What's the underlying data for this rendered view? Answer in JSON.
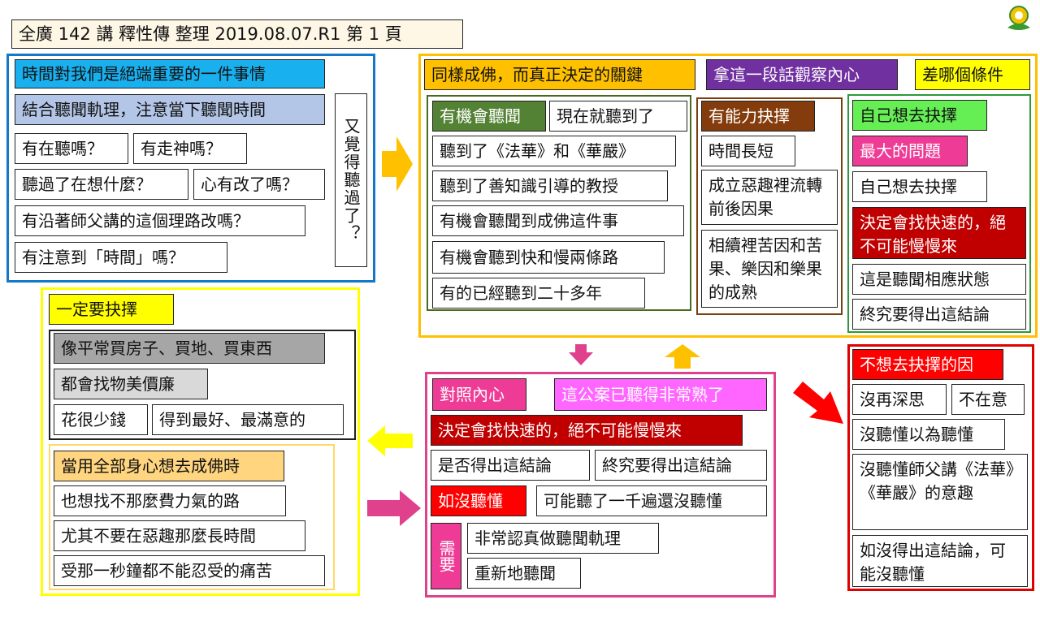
{
  "header": {
    "title": "全廣 142 講   釋性傳 整理  2019.08.07.R1   第 1 頁"
  },
  "colors": {
    "blue": "#1478c8",
    "orange": "#ffc000",
    "yellow": "#ffff00",
    "pink": "#e0418c",
    "red": "#e00000",
    "green": "#2a9a3a",
    "brown": "#7a3e10",
    "darkgreen": "#4a6a20"
  },
  "blue_box": {
    "title": "時間對我們是絕端重要的一件事情",
    "subtitle": "結合聽聞軌理，注意當下聽聞時間",
    "q1": "有在聽嗎？",
    "q2": "有走神嗎？",
    "q3": "聽過了在想什麼？",
    "q4": "心有改了嗎？",
    "q5": "有沿著師父講的這個理路改嗎？",
    "q6": "有注意到「時間」嗎？",
    "side": "又覺得聽過了？"
  },
  "orange_box": {
    "title": "同樣成佛，而真正決定的關鍵",
    "purple": "拿這一段話觀察內心",
    "yellow": "差哪個條件",
    "col1": {
      "head": "有機會聽聞",
      "head2": "現在就聽到了",
      "items": [
        "聽到了《法華》和《華嚴》",
        "聽到了善知識引導的教授",
        "有機會聽聞到成佛這件事",
        "有機會聽到快和慢兩條路",
        "有的已經聽到二十多年"
      ]
    },
    "col2": {
      "head": "有能力抉擇",
      "items": [
        "時間長短",
        "成立惡趣裡流轉前後因果",
        "相續裡苦因和苦果、樂因和樂果的成熟"
      ]
    },
    "col3": {
      "head": "自己想去抉擇",
      "problem": "最大的問題",
      "item1": "自己想去抉擇",
      "red": "決定會找快速的，絕不可能慢慢來",
      "item2": "這是聽聞相應狀態",
      "item3": "終究要得出這結論"
    }
  },
  "yellow_box": {
    "title": "一定要抉擇",
    "g1": "像平常買房子、買地、買東西",
    "g2": "都會找物美價廉",
    "g3": "花很少錢",
    "g4": "得到最好、最滿意的",
    "sub_title": "當用全部身心想去成佛時",
    "s1": "也想找不那麼費力氣的路",
    "s2": "尤其不要在惡趣那麼長時間",
    "s3": "受那一秒鐘都不能忍受的痛苦"
  },
  "pink_box": {
    "t1": "對照內心",
    "t2": "這公案已聽得非常熟了",
    "red": "決定會找快速的，絕不可能慢慢來",
    "a1": "是否得出這結論",
    "a2": "終究要得出這結論",
    "if": "如沒聽懂",
    "if_text": "可能聽了一千遍還沒聽懂",
    "need": "需要",
    "n1": "非常認真做聽聞軌理",
    "n2": "重新地聽聞"
  },
  "red_box": {
    "title": "不想去抉擇的因",
    "r1": "沒再深思",
    "r2": "不在意",
    "r3": "沒聽懂以為聽懂",
    "r4": "沒聽懂師父講《法華》《華嚴》的意趣",
    "r5": "如沒得出這結論，可能沒聽懂"
  }
}
